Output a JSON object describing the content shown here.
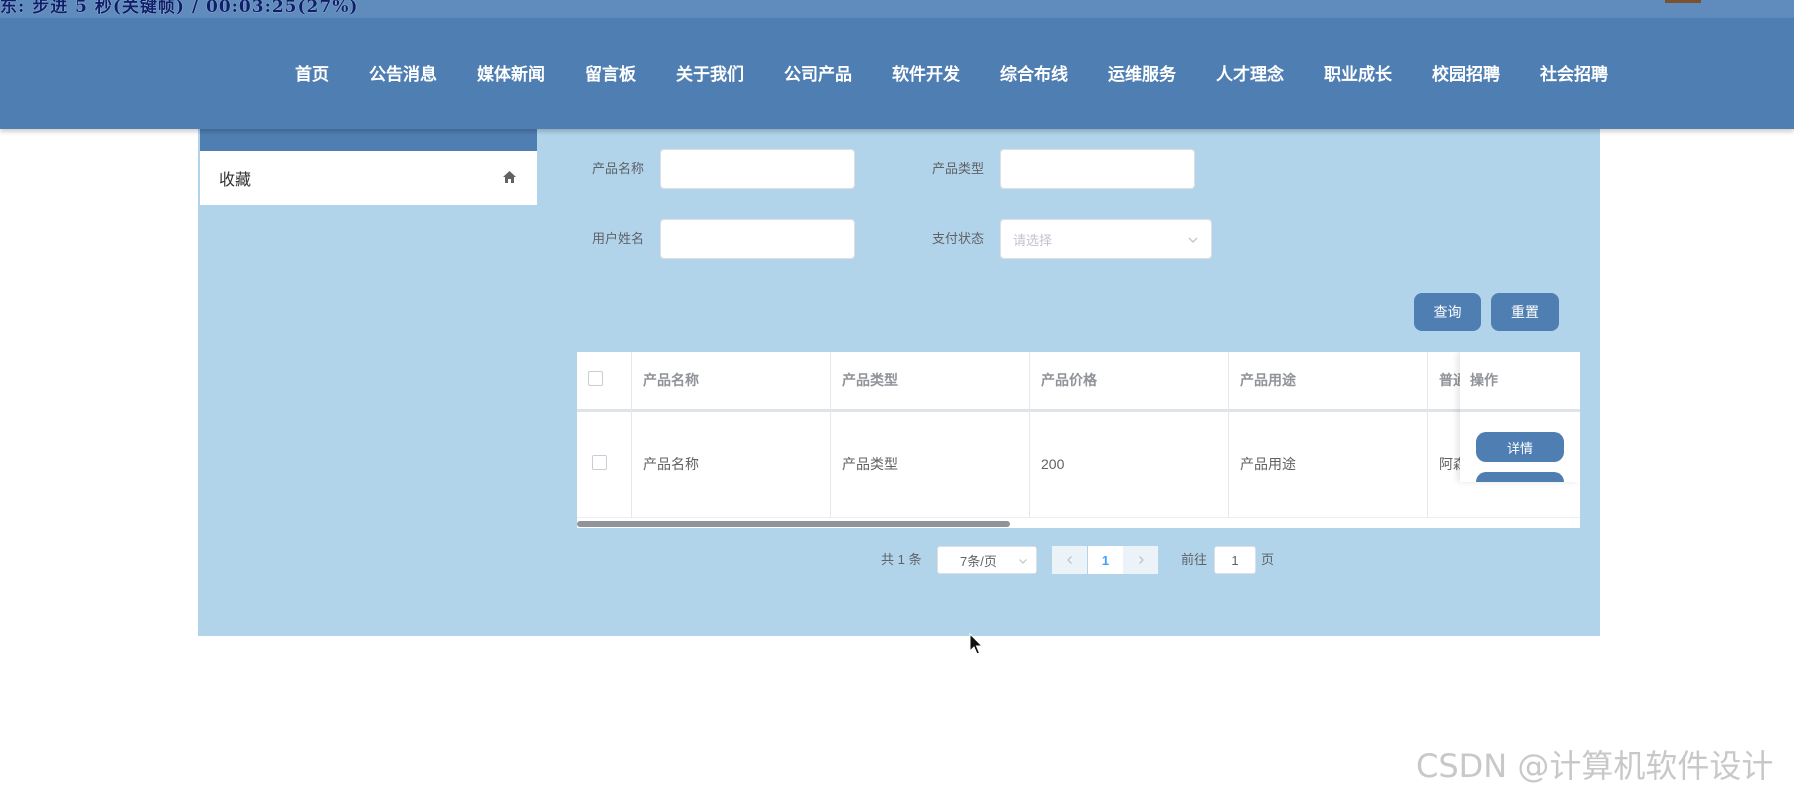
{
  "recording_overlay": {
    "text": "东: 步进 5 秒(关键帧) / 00:03:25(27%)"
  },
  "nav": {
    "items": [
      "首页",
      "公告消息",
      "媒体新闻",
      "留言板",
      "关于我们",
      "公司产品",
      "软件开发",
      "综合布线",
      "运维服务",
      "人才理念",
      "职业成长",
      "校园招聘",
      "社会招聘"
    ]
  },
  "sidebar": {
    "items": [
      {
        "label": "收藏",
        "icon": "home-icon"
      }
    ]
  },
  "search_form": {
    "product_name_label": "产品名称",
    "product_type_label": "产品类型",
    "user_name_label": "用户姓名",
    "pay_status_label": "支付状态",
    "product_name_value": "",
    "product_type_value": "",
    "user_name_value": "",
    "pay_status_placeholder": "请选择",
    "query_label": "查询",
    "reset_label": "重置"
  },
  "table": {
    "headers": [
      "产品名称",
      "产品类型",
      "产品价格",
      "产品用途",
      "普通",
      "操作"
    ],
    "rows": [
      {
        "product_name": "产品名称",
        "product_type": "产品类型",
        "price": "200",
        "usage": "产品用途",
        "partial": "阿森"
      }
    ],
    "detail_label": "详情"
  },
  "pagination": {
    "total_text": "共 1 条",
    "page_size": "7条/页",
    "current_page": "1",
    "goto_prefix": "前往",
    "goto_value": "1",
    "goto_suffix": "页"
  },
  "watermark": "CSDN @计算机软件设计",
  "colors": {
    "nav_bg": "#4f7eb2",
    "panel_bg": "#b1d4eb",
    "button_bg": "#4f7eb2",
    "page_link": "#409eff"
  }
}
